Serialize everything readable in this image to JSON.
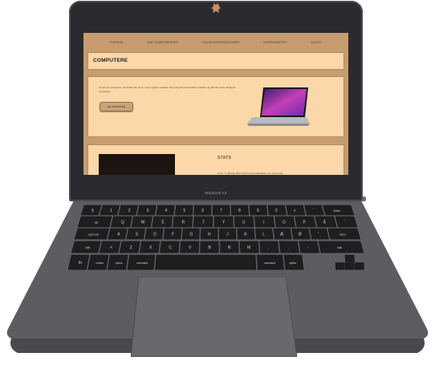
{
  "device": {
    "model_label": "MacBook Air"
  },
  "website": {
    "nav": [
      "FORSIDE",
      "MAC KOMPONENTER",
      "UDVIKLINGSAFDELINGER",
      "KOMPONENTER",
      "KALIOR"
    ],
    "title": "COMPUTERE",
    "intro": "Vi ved om computere: Herunder kan du se vores nyeste modeller. Få et kig på vores bedste modeller og udforsk vores udvalg af computere.",
    "cta_label": "SE COMPUTER",
    "stats_title": "STATS",
    "stats_text": "Fra d. 1. februar 2022 vil der vises statistikker over vores salg"
  },
  "keyboard": {
    "number_row": [
      "§",
      "1",
      "2",
      "3",
      "4",
      "5",
      "6",
      "7",
      "8",
      "9",
      "0",
      "+",
      "´",
      "delete"
    ],
    "top_row": [
      "tab",
      "Q",
      "W",
      "E",
      "R",
      "T",
      "Y",
      "U",
      "I",
      "O",
      "P",
      "Å",
      "¨"
    ],
    "home_row": [
      "caps lock",
      "A",
      "S",
      "D",
      "F",
      "G",
      "H",
      "J",
      "K",
      "L",
      "Æ",
      "Ø",
      "'",
      "return"
    ],
    "bottom_row": [
      "shift",
      "<",
      "Z",
      "X",
      "C",
      "V",
      "B",
      "N",
      "M",
      ",",
      ".",
      "-",
      "shift"
    ],
    "modifier_row": [
      "fn",
      "control",
      "option",
      "command",
      "",
      "command",
      "option"
    ]
  },
  "colors": {
    "screen_bg": "#c79c6f",
    "card_bg": "#fcd7a9",
    "laptop_body": "#5c5d61",
    "key": "#1e1e20"
  }
}
